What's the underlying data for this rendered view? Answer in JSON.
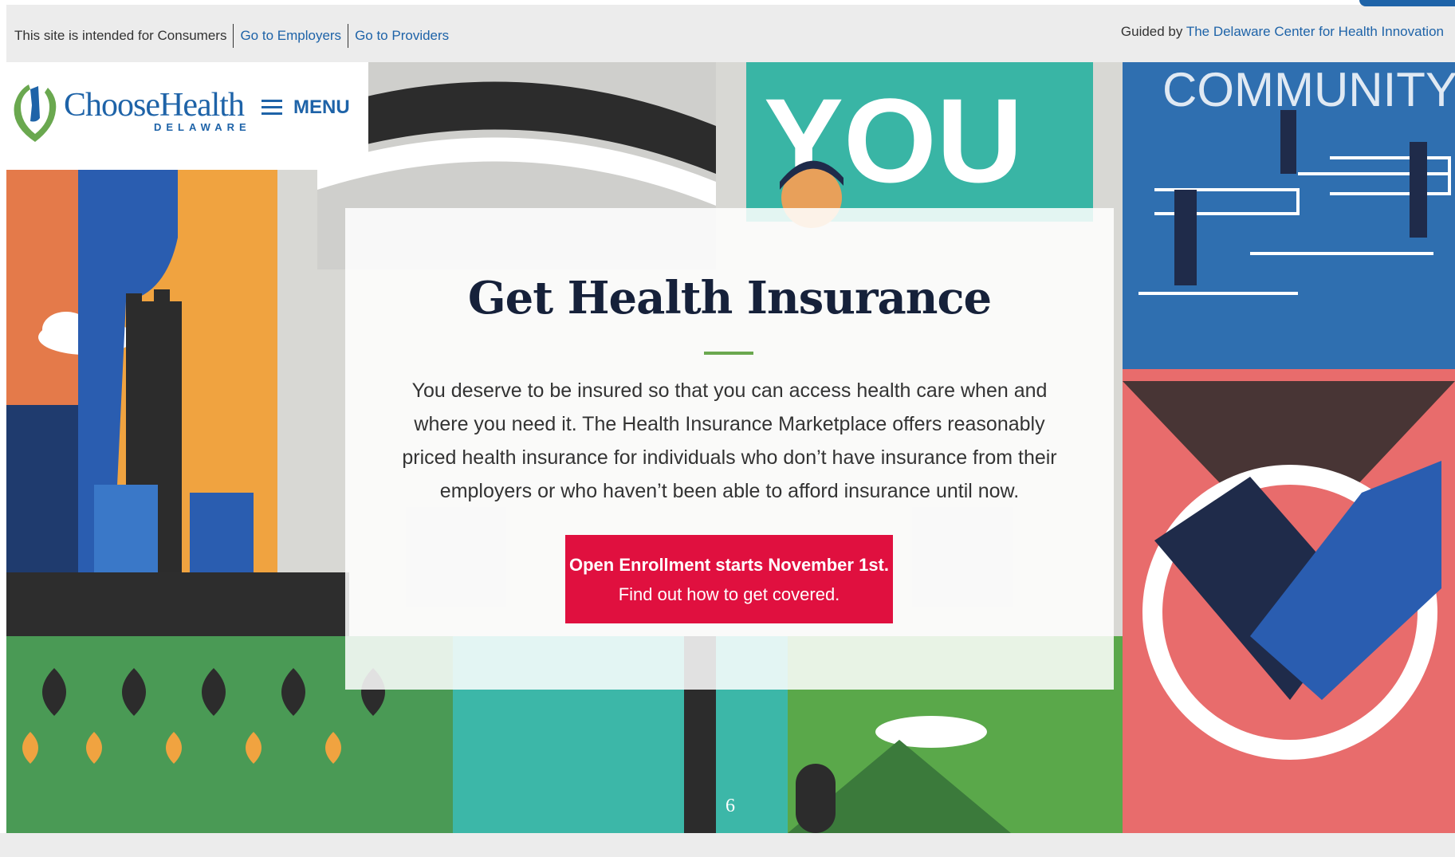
{
  "topbar": {
    "intended_text": "This site is intended for Consumers",
    "employers_link": "Go to Employers",
    "providers_link": "Go to Providers",
    "guided_by_text": "Guided by",
    "guided_by_link": "The Delaware Center for Health Innovation"
  },
  "header": {
    "logo_text": "ChooseHealth",
    "logo_subtext": "DELAWARE",
    "menu_label": "MENU"
  },
  "hero": {
    "tiles": {
      "you_text": "YOU",
      "community_text": "COMMUNITY"
    }
  },
  "card": {
    "title": "Get Health Insurance",
    "body": "You deserve to be insured so that you can access health care when and where you need it. The Health Insurance Marketplace offers reasonably priced health insurance for individuals who don’t have insurance from their employers or who haven’t been able to afford insurance until now.",
    "cta_line1": "Open Enrollment starts November 1st.",
    "cta_line2": "Find out how to get covered."
  },
  "page_number": "6",
  "colors": {
    "brand_blue": "#1e63a8",
    "cta_red": "#e0103f",
    "accent_green": "#6aa84f",
    "title_navy": "#16213a"
  }
}
